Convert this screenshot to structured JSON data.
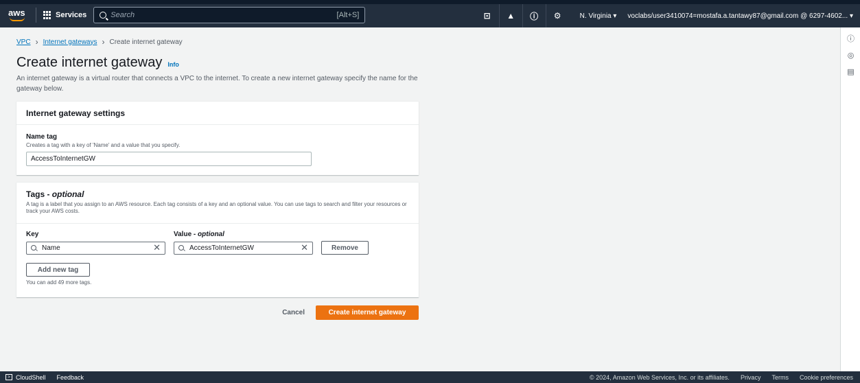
{
  "nav": {
    "logo": "aws",
    "services": "Services",
    "search_placeholder": "Search",
    "search_shortcut": "[Alt+S]",
    "region": "N. Virginia ▾",
    "account": "voclabs/user3410074=mostafa.a.tantawy87@gmail.com @ 6297-4602... ▾"
  },
  "breadcrumb": {
    "vpc": "VPC",
    "igw": "Internet gateways",
    "current": "Create internet gateway"
  },
  "page": {
    "title": "Create internet gateway",
    "info": "Info",
    "description": "An internet gateway is a virtual router that connects a VPC to the internet. To create a new internet gateway specify the name for the gateway below."
  },
  "settings": {
    "header": "Internet gateway settings",
    "name_label": "Name tag",
    "name_hint": "Creates a tag with a key of 'Name' and a value that you specify.",
    "name_value": "AccessToInternetGW"
  },
  "tags": {
    "header": "Tags - ",
    "header_optional": "optional",
    "description": "A tag is a label that you assign to an AWS resource. Each tag consists of a key and an optional value. You can use tags to search and filter your resources or track your AWS costs.",
    "key_label": "Key",
    "value_label": "Value - ",
    "value_optional": "optional",
    "rows": [
      {
        "key": "Name",
        "value": "AccessToInternetGW"
      }
    ],
    "remove": "Remove",
    "add_new": "Add new tag",
    "remaining": "You can add 49 more tags."
  },
  "actions": {
    "cancel": "Cancel",
    "create": "Create internet gateway"
  },
  "footer": {
    "cloudshell": "CloudShell",
    "feedback": "Feedback",
    "copyright": "© 2024, Amazon Web Services, Inc. or its affiliates.",
    "privacy": "Privacy",
    "terms": "Terms",
    "cookies": "Cookie preferences"
  },
  "colors": {
    "nav_bg": "#232f3e",
    "link": "#0073bb",
    "primary": "#ec7211"
  }
}
